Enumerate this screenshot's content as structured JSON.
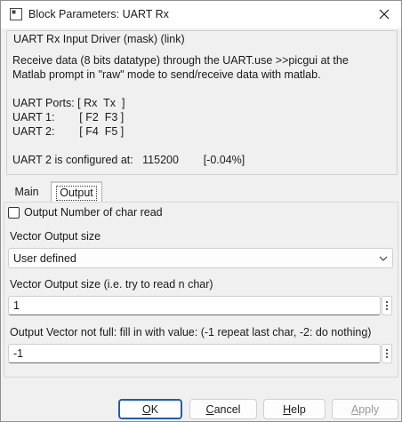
{
  "window": {
    "title": "Block Parameters: UART Rx"
  },
  "mask": {
    "title": "UART Rx Input Driver (mask) (link)",
    "description_lines": [
      "Receive data (8 bits datatype) through the UART.use >>picgui at the",
      "Matlab prompt in \"raw\" mode to send/receive data with matlab.",
      "",
      "UART Ports: [ Rx  Tx  ]",
      "UART 1:        [ F2  F3 ]",
      "UART 2:        [ F4  F5 ]",
      "",
      "UART 2 is configured at:   115200        [-0.04%]"
    ]
  },
  "tabs": [
    {
      "label": "Main"
    },
    {
      "label": "Output",
      "selected": true
    }
  ],
  "output": {
    "checkbox_label": "Output Number of char read",
    "checkbox_checked": false,
    "vector_size_label": "Vector Output size",
    "vector_size_value": "User defined",
    "n_char_label": "Vector Output size (i.e. try to read n char)",
    "n_char_value": "1",
    "fill_label": "Output Vector not full: fill in with value: (-1 repeat last char, -2: do nothing)",
    "fill_value": "-1"
  },
  "buttons": {
    "ok": {
      "prefix": "",
      "hotkey": "O",
      "rest": "K"
    },
    "cancel": {
      "prefix": "",
      "hotkey": "C",
      "rest": "ancel"
    },
    "help": {
      "prefix": "",
      "hotkey": "H",
      "rest": "elp"
    },
    "apply": {
      "prefix": "",
      "hotkey": "A",
      "rest": "pply"
    }
  },
  "colors": {
    "ok_border": "#1b5fb8",
    "disabled_text": "#9a9a9a"
  }
}
